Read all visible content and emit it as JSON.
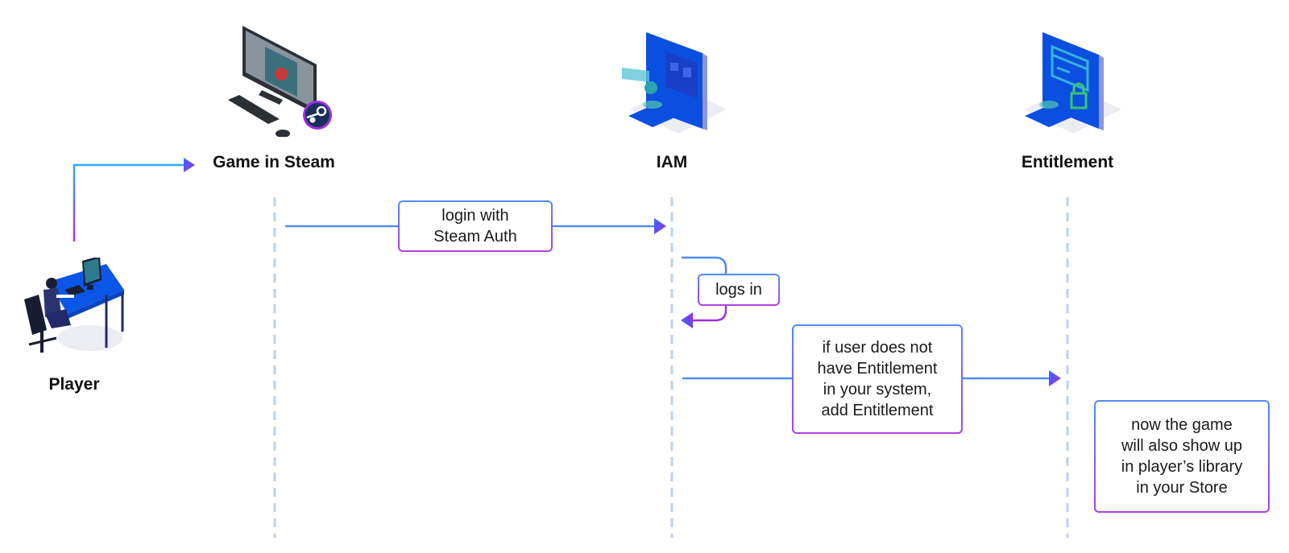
{
  "diagram": {
    "type": "sequence",
    "colors": {
      "arrow_line": "#4f8cf7",
      "arrow_gradient_start": "#2f7bff",
      "arrow_gradient_end": "#9b2de0",
      "lifeline": "#b9d2f0",
      "box_border_top": "#4f8cf7",
      "box_border_bottom": "#b23ee0",
      "label_text": "#111111"
    },
    "actors": [
      {
        "id": "player",
        "label": "Player",
        "icon": "person-at-desk-icon"
      },
      {
        "id": "game_in_steam",
        "label": "Game in Steam",
        "icon": "desktop-steam-icon"
      },
      {
        "id": "iam",
        "label": "IAM",
        "icon": "iam-server-icon"
      },
      {
        "id": "entitlement",
        "label": "Entitlement",
        "icon": "entitlement-lock-icon"
      }
    ],
    "messages": [
      {
        "from": "player",
        "to": "game_in_steam",
        "label": ""
      },
      {
        "from": "game_in_steam",
        "to": "iam",
        "label": "login with\nSteam Auth"
      },
      {
        "from": "iam",
        "to": "iam",
        "label": "logs in"
      },
      {
        "from": "iam",
        "to": "entitlement",
        "label": "if user does not\nhave Entitlement\nin your system,\nadd Entitlement"
      }
    ],
    "notes": [
      {
        "actor": "entitlement",
        "label": "now the game\nwill also show up\nin player’s library\nin your Store"
      }
    ]
  }
}
